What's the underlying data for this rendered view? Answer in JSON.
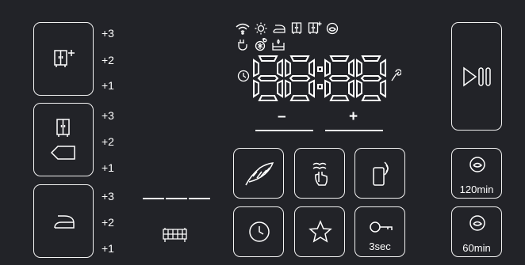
{
  "display": {
    "time": "88:88",
    "minus": "–",
    "plus": "+"
  },
  "levels": {
    "dry_cupboard": [
      "+3",
      "+2",
      "+1"
    ],
    "dry_cupboard_iron": [
      "+3",
      "+2",
      "+1"
    ],
    "iron": [
      "+3",
      "+2",
      "+1"
    ]
  },
  "buttons": {
    "child_lock_label": "3sec",
    "drum_clean_120": "120min",
    "drum_clean_60": "60min"
  },
  "status_icons": [
    "wifi-icon",
    "sun-icon",
    "iron-icon",
    "wardrobe-icon",
    "wardrobe-plus-icon",
    "drum-icon",
    "tap-icon",
    "lint-filter-icon",
    "water-tank-icon",
    "clock-icon",
    "wrench-icon"
  ],
  "colors": {
    "background": "#222328",
    "foreground": "#ffffff"
  }
}
